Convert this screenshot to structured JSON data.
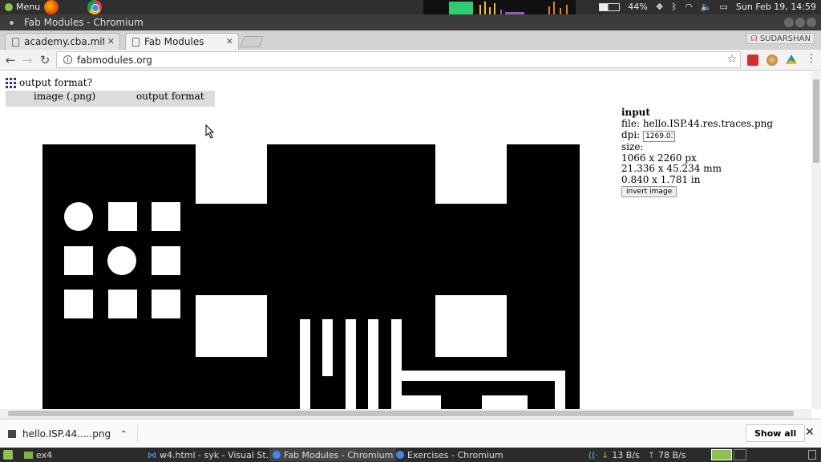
{
  "system_panel": {
    "menu_label": "Menu",
    "battery": "44%",
    "clock": "Sun Feb 19, 14:59"
  },
  "window": {
    "title": "Fab Modules - Chromium"
  },
  "tabs": [
    {
      "label": "academy.cba.mit.e",
      "active": false
    },
    {
      "label": "Fab Modules",
      "active": true
    }
  ],
  "profile_name": "SUDARSHAN",
  "address_bar": {
    "url": "fabmodules.org"
  },
  "page": {
    "prompt": "output format?",
    "format_menu": {
      "input_format": "image (.png)",
      "output_format": "output format"
    },
    "input_panel": {
      "heading": "input",
      "file_label": "file:",
      "file_name": "hello.ISP.44.res.traces.png",
      "dpi_label": "dpi:",
      "dpi_value": "1269.03",
      "size_label": "size:",
      "size_px": "1066 x 2260 px",
      "size_mm": "21.336 x 45.234 mm",
      "size_in": "0.840 x 1.781 in",
      "invert_button": "invert image"
    }
  },
  "downloads": {
    "file": "hello.ISP.44.....png",
    "show_all": "Show all"
  },
  "taskbar": {
    "items": [
      {
        "label": "ex4",
        "icon": "folder-icon"
      },
      {
        "label": "w4.html - syk - Visual St...",
        "icon": "vscode-icon"
      },
      {
        "label": "Fab Modules - Chromium",
        "icon": "chromium-icon"
      },
      {
        "label": "Exercises - Chromium",
        "icon": "chromium-icon"
      }
    ],
    "net_down": "13 B/s",
    "net_up": "78 B/s"
  },
  "colors": {
    "pcb_copper": "#000000",
    "pcb_background": "#ffffff",
    "panel_dark": "#2f2f2f"
  }
}
